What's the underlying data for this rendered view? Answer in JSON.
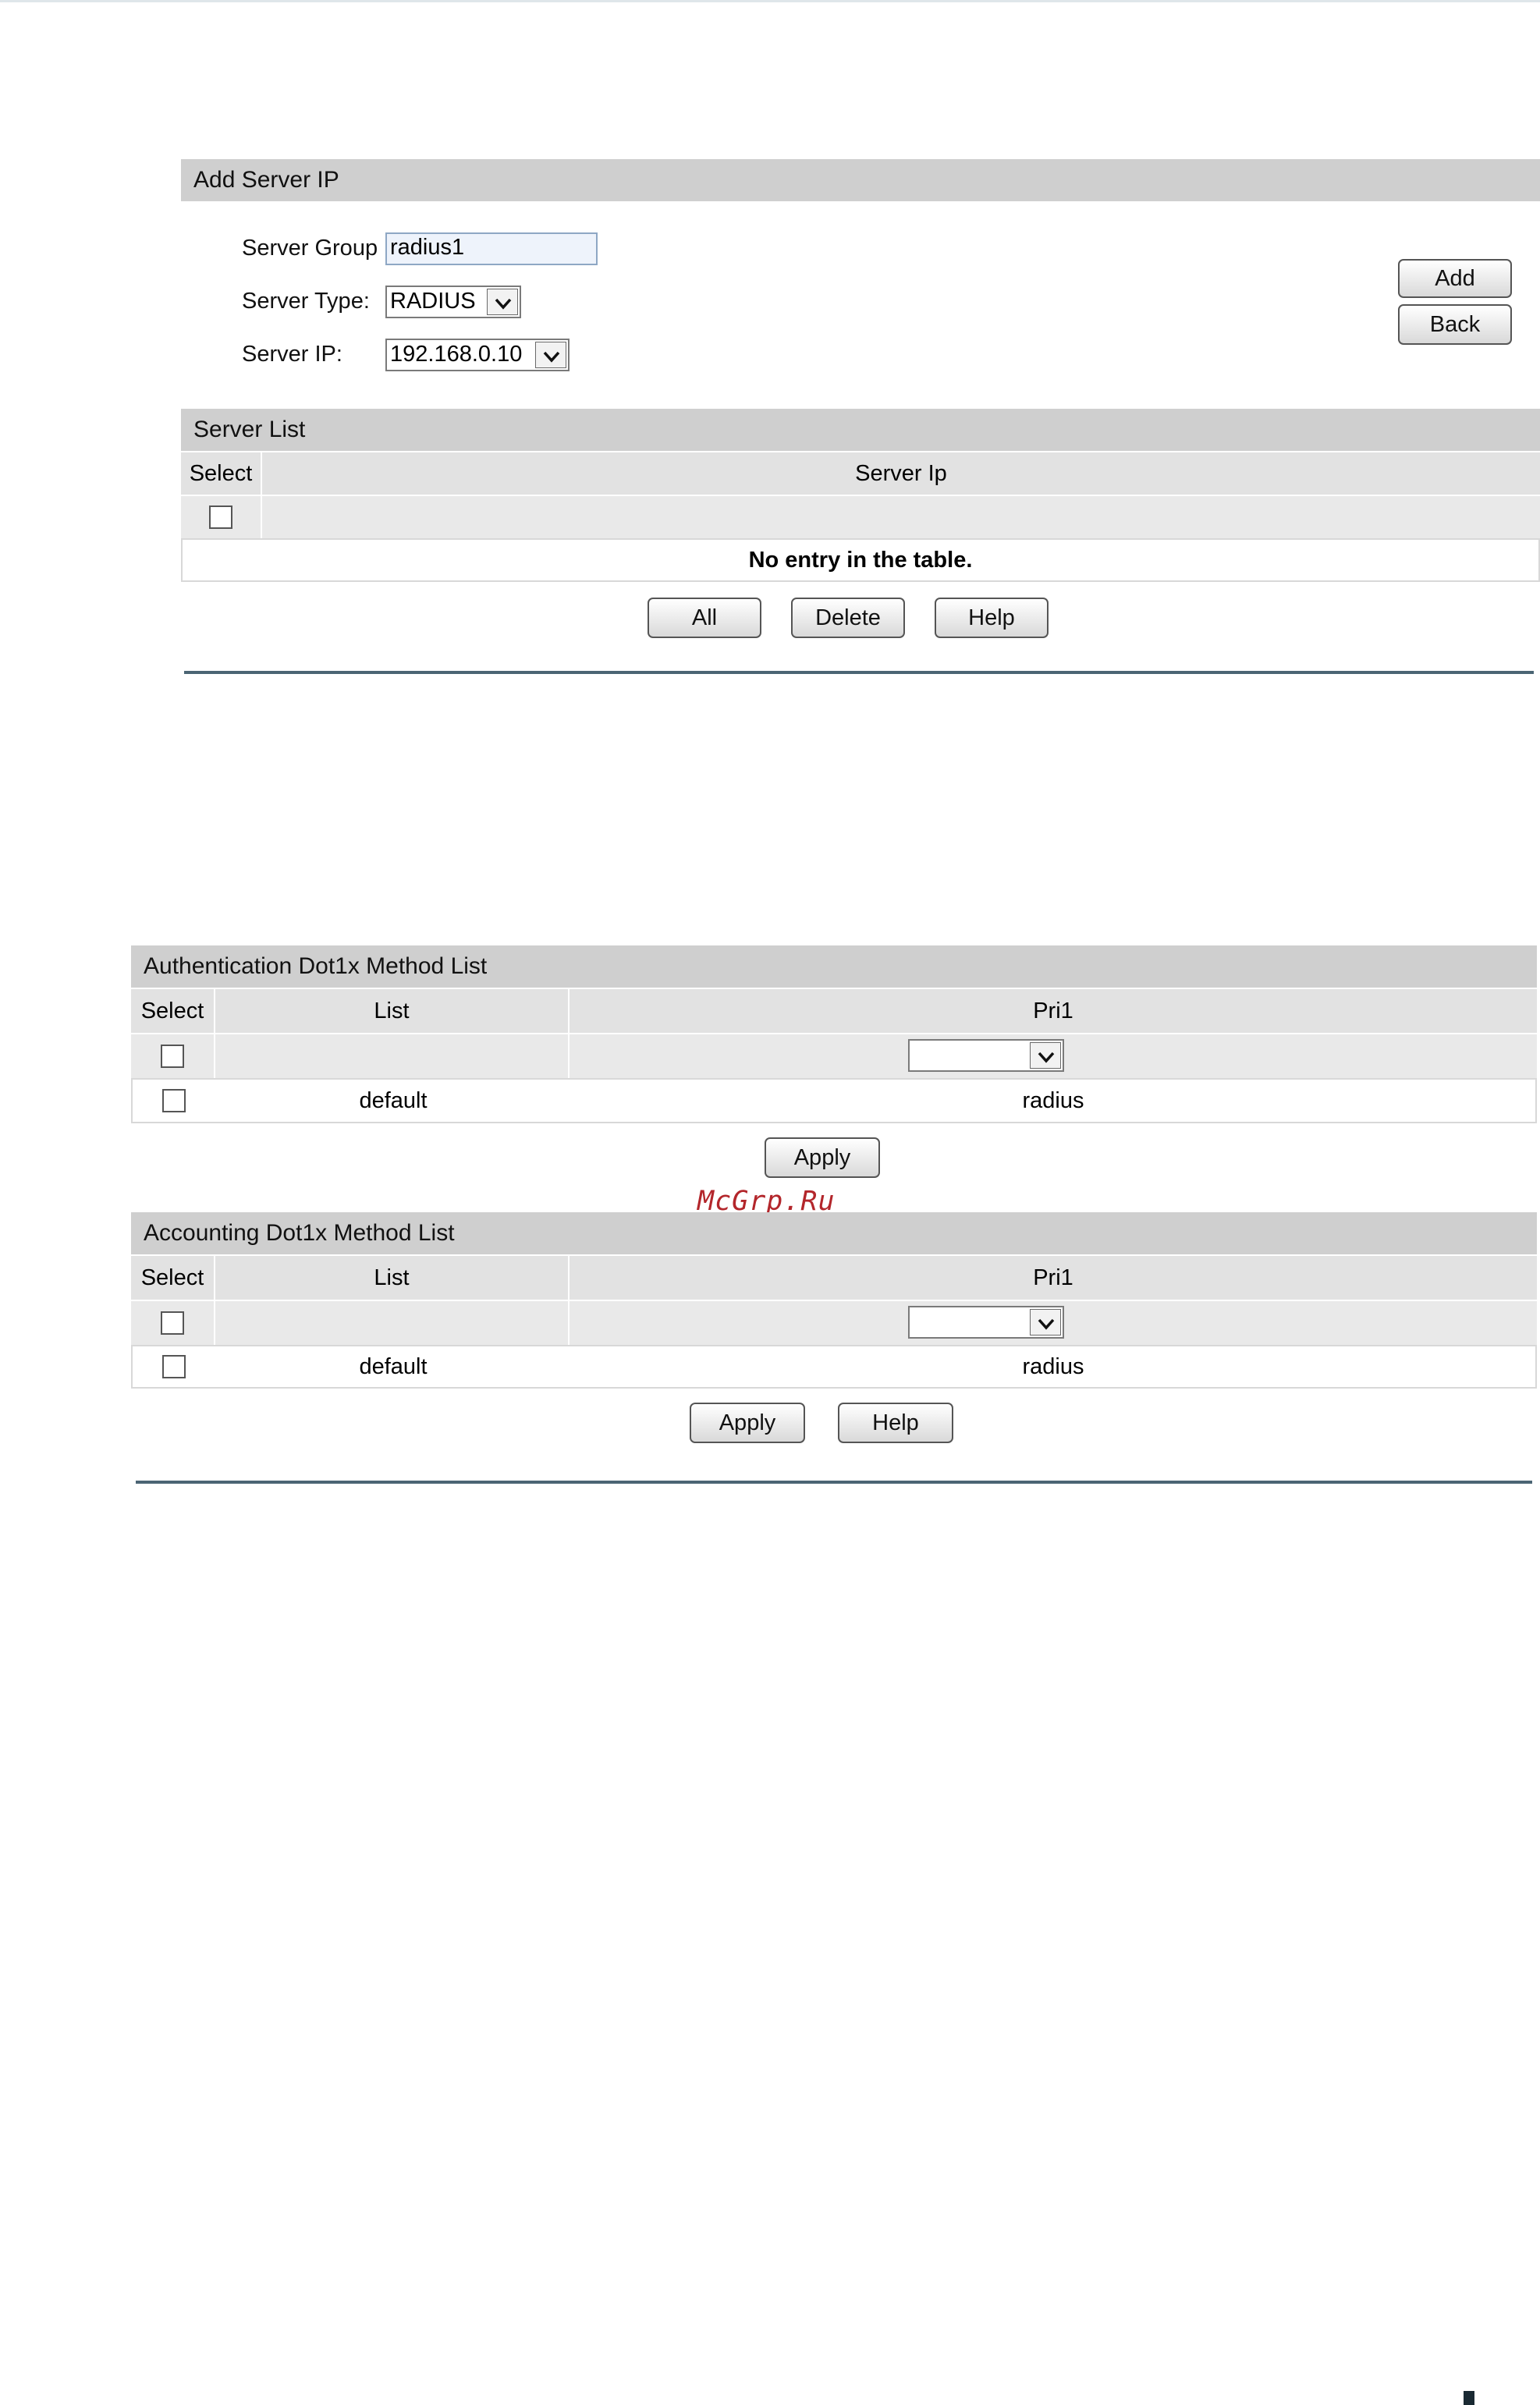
{
  "add_server": {
    "title": "Add Server IP",
    "server_group_label": "Server Group",
    "server_group_value": "radius1",
    "server_type_label": "Server Type:",
    "server_type_value": "RADIUS",
    "server_ip_label": "Server IP:",
    "server_ip_value": "192.168.0.10",
    "add_label": "Add",
    "back_label": "Back"
  },
  "server_list": {
    "title": "Server List",
    "columns": [
      "Select",
      "Server Ip"
    ],
    "empty_message": "No entry in the table.",
    "buttons": {
      "all": "All",
      "delete": "Delete",
      "help": "Help"
    }
  },
  "auth_list": {
    "title": "Authentication Dot1x Method List",
    "columns": [
      "Select",
      "List",
      "Pri1"
    ],
    "rows": [
      {
        "list": "default",
        "pri1": "radius"
      }
    ],
    "apply_label": "Apply"
  },
  "acct_list": {
    "title": "Accounting Dot1x Method List",
    "columns": [
      "Select",
      "List",
      "Pri1"
    ],
    "rows": [
      {
        "list": "default",
        "pri1": "radius"
      }
    ],
    "apply_label": "Apply",
    "help_label": "Help"
  },
  "watermark": "McGrp.Ru",
  "icons": [
    "checkbox",
    "chevron-down-icon"
  ],
  "colors": {
    "header_bar": "#cfcfcf",
    "rule": "#4b6574",
    "watermark": "#b3262b"
  }
}
